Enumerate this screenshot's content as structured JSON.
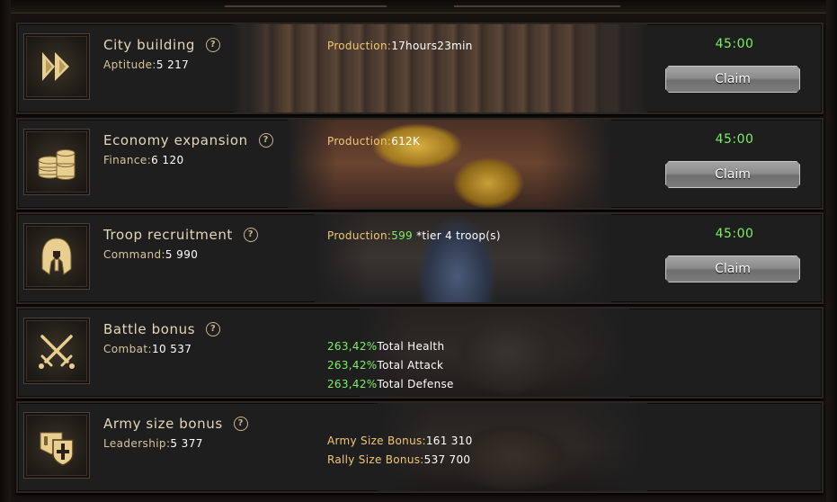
{
  "rows": [
    {
      "title": "City building",
      "stat_label": "Aptitude:",
      "stat_value": "5 217",
      "prod_label": "Production:",
      "prod_value": "17hours23min",
      "timer": "45:00",
      "claim_label": "Claim",
      "icon": "double-chevron-right-icon"
    },
    {
      "title": "Economy expansion",
      "stat_label": "Finance:",
      "stat_value": "6 120",
      "prod_label": "Production:",
      "prod_value": "612K",
      "timer": "45:00",
      "claim_label": "Claim",
      "icon": "coin-stack-icon"
    },
    {
      "title": "Troop recruitment",
      "stat_label": "Command:",
      "stat_value": "5 990",
      "prod_label": "Production:",
      "prod_value": "599",
      "prod_suffix": " *tier 4 troop(s)",
      "timer": "45:00",
      "claim_label": "Claim",
      "icon": "spartan-helmet-icon"
    },
    {
      "title": "Battle bonus",
      "stat_label": "Combat:",
      "stat_value": "10 537",
      "bonuses": [
        {
          "value": "263,42%",
          "label": "Total Health"
        },
        {
          "value": "263,42%",
          "label": "Total Attack"
        },
        {
          "value": "263,42%",
          "label": "Total Defense"
        }
      ],
      "icon": "crossed-swords-icon"
    },
    {
      "title": "Army size bonus",
      "stat_label": "Leadership:",
      "stat_value": "5 377",
      "army_label": "Army Size Bonus:",
      "army_value": "161 310",
      "rally_label": "Rally Size Bonus:",
      "rally_value": "537 700",
      "icon": "banner-shield-icon"
    }
  ],
  "help_glyph": "?",
  "colors": {
    "gold": "#f0c874",
    "green": "#7cf060",
    "title": "#e4d6b8",
    "icon": "#e8cf8f"
  }
}
